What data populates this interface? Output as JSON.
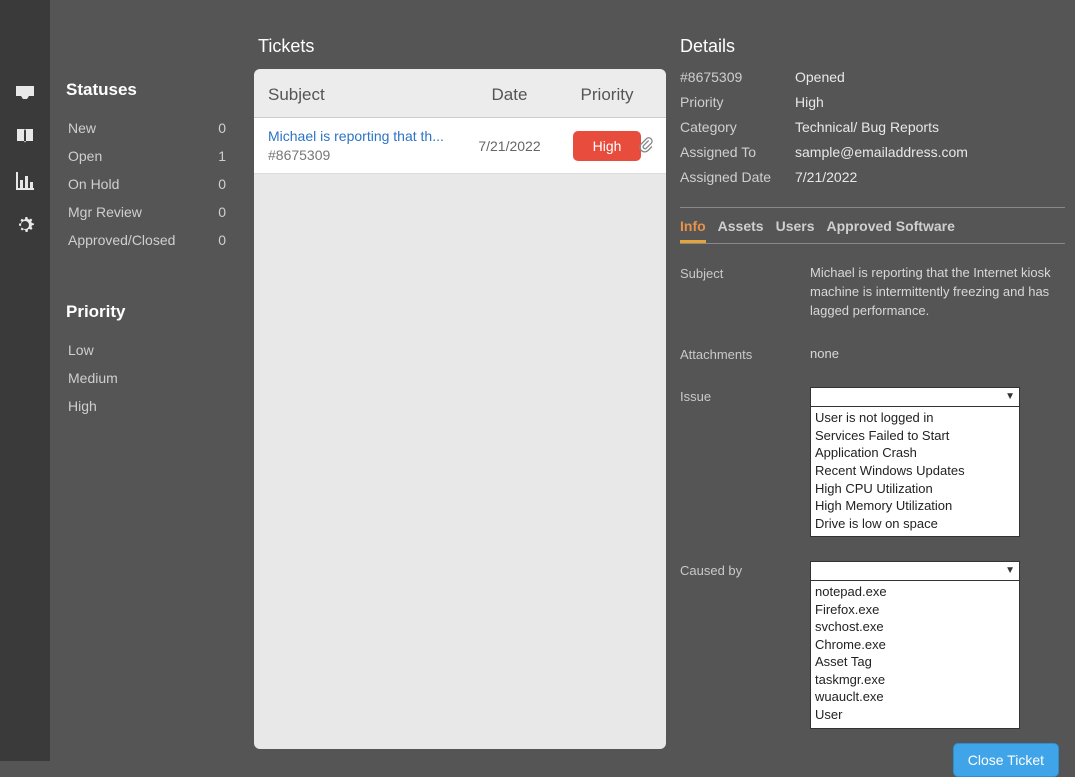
{
  "sidebar": {
    "statuses_heading": "Statuses",
    "statuses": [
      {
        "label": "New",
        "count": "0"
      },
      {
        "label": "Open",
        "count": "1"
      },
      {
        "label": "On Hold",
        "count": "0"
      },
      {
        "label": "Mgr Review",
        "count": "0"
      },
      {
        "label": "Approved/Closed",
        "count": "0"
      }
    ],
    "priority_heading": "Priority",
    "priorities": [
      {
        "label": "Low"
      },
      {
        "label": "Medium"
      },
      {
        "label": "High"
      }
    ]
  },
  "tickets": {
    "heading": "Tickets",
    "columns": {
      "subject": "Subject",
      "date": "Date",
      "priority": "Priority"
    },
    "rows": [
      {
        "subject": "Michael is reporting that th...",
        "ticket_no": "#8675309",
        "date": "7/21/2022",
        "priority": "High"
      }
    ]
  },
  "details": {
    "heading": "Details",
    "ticket_no": "#8675309",
    "status": "Opened",
    "priority_label": "Priority",
    "priority_value": "High",
    "category_label": "Category",
    "category_value": "Technical/ Bug Reports",
    "assigned_to_label": "Assigned To",
    "assigned_to_value": "sample@emailaddress.com",
    "assigned_date_label": "Assigned Date",
    "assigned_date_value": "7/21/2022",
    "tabs": {
      "info": "Info",
      "assets": "Assets",
      "users": "Users",
      "approved": "Approved Software"
    },
    "info": {
      "subject_label": "Subject",
      "subject_value": "Michael is reporting that the Internet kiosk machine is intermittently freezing and has lagged performance.",
      "attachments_label": "Attachments",
      "attachments_value": "none",
      "issue_label": "Issue",
      "issue_options": [
        "User is not logged in",
        "Services Failed to Start",
        "Application Crash",
        "Recent Windows Updates",
        "High CPU Utilization",
        "High Memory Utilization",
        "Drive is low on space"
      ],
      "caused_by_label": "Caused by",
      "caused_by_options": [
        "notepad.exe",
        "Firefox.exe",
        "svchost.exe",
        "Chrome.exe",
        "Asset Tag",
        "taskmgr.exe",
        "wuauclt.exe",
        "User"
      ]
    },
    "close_button": "Close Ticket"
  }
}
